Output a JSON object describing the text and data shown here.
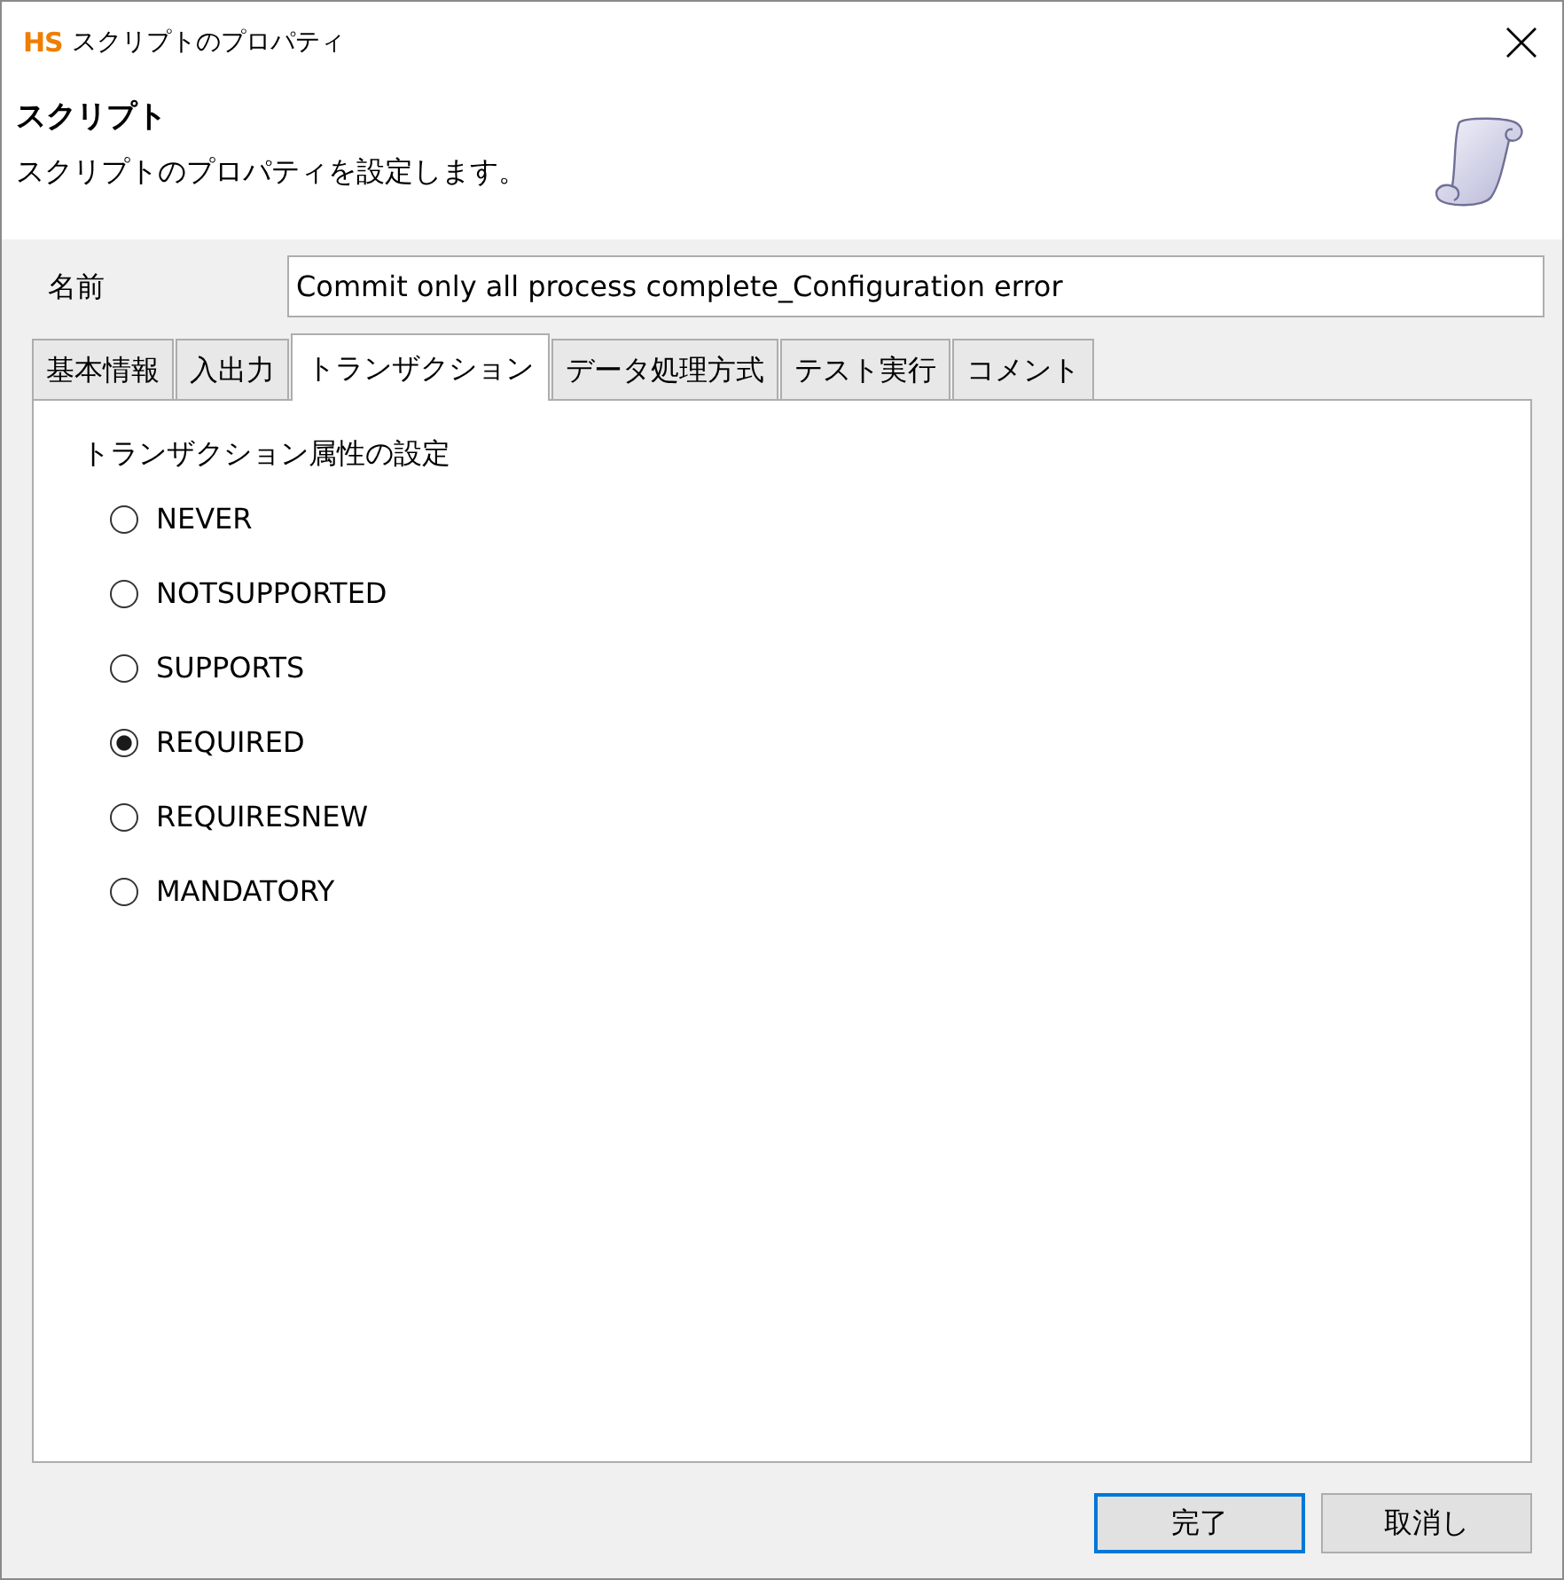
{
  "window": {
    "logo": "HS",
    "title": "スクリプトのプロパティ"
  },
  "header": {
    "title": "スクリプト",
    "description": "スクリプトのプロパティを設定します。"
  },
  "name_field": {
    "label": "名前",
    "value": "Commit only all process complete_Configuration error"
  },
  "tabs": [
    {
      "label": "基本情報",
      "selected": false
    },
    {
      "label": "入出力",
      "selected": false
    },
    {
      "label": "トランザクション",
      "selected": true
    },
    {
      "label": "データ処理方式",
      "selected": false
    },
    {
      "label": "テスト実行",
      "selected": false
    },
    {
      "label": "コメント",
      "selected": false
    }
  ],
  "panel": {
    "heading": "トランザクション属性の設定",
    "options": [
      {
        "label": "NEVER",
        "selected": false
      },
      {
        "label": "NOTSUPPORTED",
        "selected": false
      },
      {
        "label": "SUPPORTS",
        "selected": false
      },
      {
        "label": "REQUIRED",
        "selected": true
      },
      {
        "label": "REQUIRESNEW",
        "selected": false
      },
      {
        "label": "MANDATORY",
        "selected": false
      }
    ]
  },
  "buttons": [
    {
      "label": "完了",
      "kind": "default"
    },
    {
      "label": "取消し",
      "kind": "normal"
    }
  ]
}
